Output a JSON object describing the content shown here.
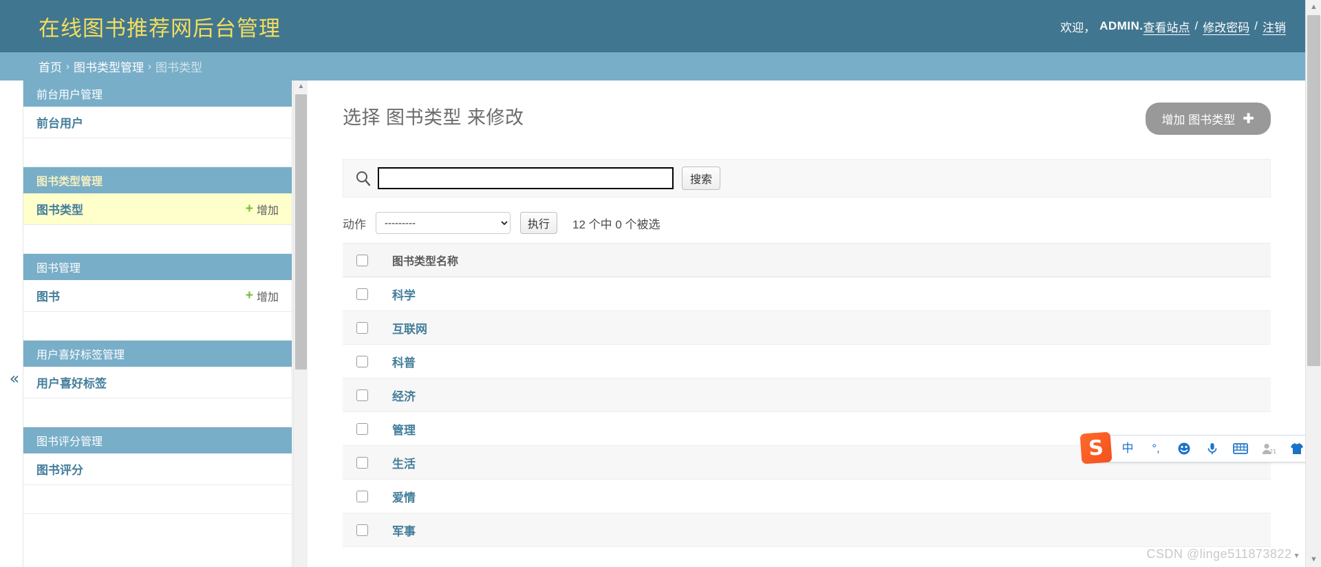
{
  "header": {
    "site_title": "在线图书推荐网后台管理",
    "welcome": "欢迎，",
    "username": "ADMIN.",
    "links": [
      {
        "label": "查看站点"
      },
      {
        "label": "修改密码"
      },
      {
        "label": "注销"
      }
    ],
    "separator": "/"
  },
  "breadcrumbs": {
    "items": [
      {
        "label": "首页",
        "current": false
      },
      {
        "label": "图书类型管理",
        "current": false
      },
      {
        "label": "图书类型",
        "current": true
      }
    ],
    "separator": "›"
  },
  "sidebar": {
    "collapse_icon": "«",
    "add_label": "增加",
    "modules": [
      {
        "title": "前台用户管理",
        "active": false,
        "models": [
          {
            "name": "前台用户",
            "has_add": false,
            "current": false
          }
        ]
      },
      {
        "title": "图书类型管理",
        "active": true,
        "models": [
          {
            "name": "图书类型",
            "has_add": true,
            "current": true
          }
        ]
      },
      {
        "title": "图书管理",
        "active": false,
        "models": [
          {
            "name": "图书",
            "has_add": true,
            "current": false
          }
        ]
      },
      {
        "title": "用户喜好标签管理",
        "active": false,
        "models": [
          {
            "name": "用户喜好标签",
            "has_add": false,
            "current": false
          }
        ]
      },
      {
        "title": "图书评分管理",
        "active": false,
        "models": [
          {
            "name": "图书评分",
            "has_add": false,
            "current": false
          }
        ]
      }
    ]
  },
  "main": {
    "page_title": "选择 图书类型 来修改",
    "add_button": {
      "label": "增加 图书类型",
      "icon": "plus-icon"
    },
    "search": {
      "value": "",
      "placeholder": "",
      "submit_label": "搜索",
      "icon": "search-icon"
    },
    "actions": {
      "label": "动作",
      "selected": "---------",
      "options": [
        "---------"
      ],
      "go_label": "执行",
      "counter": "12 个中 0 个被选"
    },
    "table": {
      "columns": [
        "图书类型名称"
      ],
      "select_all_checked": false,
      "rows": [
        {
          "name": "科学",
          "checked": false
        },
        {
          "name": "互联网",
          "checked": false
        },
        {
          "name": "科普",
          "checked": false
        },
        {
          "name": "经济",
          "checked": false
        },
        {
          "name": "管理",
          "checked": false
        },
        {
          "name": "生活",
          "checked": false
        },
        {
          "name": "爱情",
          "checked": false
        },
        {
          "name": "军事",
          "checked": false
        }
      ]
    }
  },
  "ime": {
    "logo": "S",
    "items": [
      {
        "name": "chinese-mode-icon",
        "glyph": "中"
      },
      {
        "name": "punctuation-icon",
        "glyph": "°,"
      },
      {
        "name": "emoji-icon",
        "glyph": "☺"
      },
      {
        "name": "voice-input-icon",
        "glyph": "🎤"
      },
      {
        "name": "soft-keyboard-icon",
        "glyph": "⌨"
      },
      {
        "name": "user-profile-icon",
        "glyph": "21"
      },
      {
        "name": "skin-icon",
        "glyph": "👕"
      },
      {
        "name": "toolbox-icon",
        "glyph": "▦"
      }
    ]
  },
  "watermark": {
    "text": "CSDN @linge511873822"
  },
  "colors": {
    "header_bg": "#417690",
    "breadcrumb_bg": "#79aec8",
    "title_yellow": "#f5dd5d",
    "link_blue": "#447e9b",
    "current_row": "#ffffcc",
    "add_green": "#70bf2b",
    "button_gray": "#999999"
  }
}
